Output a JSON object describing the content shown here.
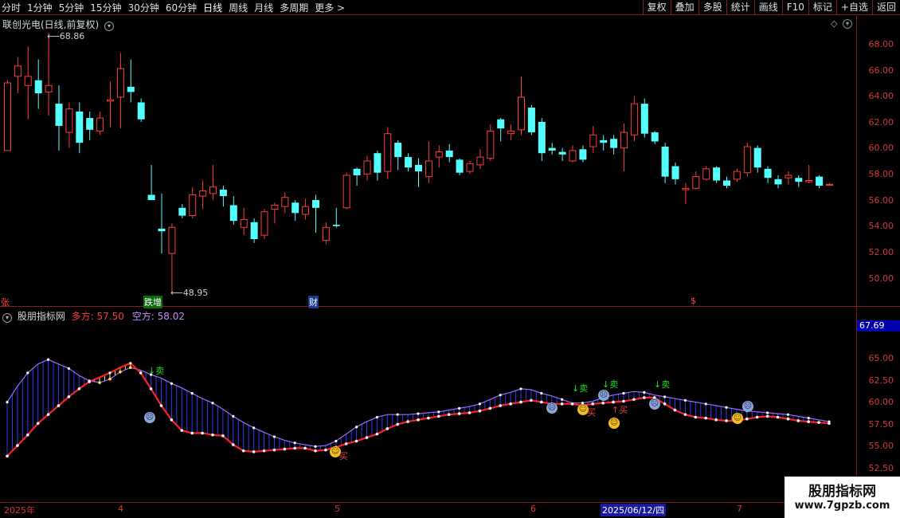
{
  "toolbar": {
    "left": [
      "分时",
      "1分钟",
      "5分钟",
      "15分钟",
      "30分钟",
      "60分钟",
      "日线",
      "周线",
      "月线",
      "多周期",
      "更多 >"
    ],
    "right": [
      "复权",
      "叠加",
      "多股",
      "统计",
      "画线",
      "F10",
      "标记",
      "+自选",
      "返回"
    ]
  },
  "main": {
    "title": "联创光电(日线,前复权)",
    "high_label": "68.86",
    "low_label": "48.95",
    "price_ticks": [
      "68.00",
      "66.00",
      "64.00",
      "62.00",
      "60.00",
      "58.00",
      "56.00",
      "54.00",
      "52.00",
      "50.00"
    ],
    "tags": {
      "zhang": "张",
      "diezeng": "跌增",
      "cai": "财",
      "dollar": "$"
    }
  },
  "indicator": {
    "name": "股朋指标网",
    "duo_label": "多方:",
    "duo_value": "57.50",
    "kong_label": "空方:",
    "kong_value": "58.02",
    "current_value": "67.69",
    "ticks": [
      "65.00",
      "62.50",
      "60.00",
      "57.50",
      "55.00",
      "52.50"
    ],
    "sell_label": "↓卖",
    "buy_label": "↑买",
    "buy_label2": "买"
  },
  "dates": {
    "d1": "2025年",
    "d2": "4",
    "d3": "5",
    "d4": "6",
    "d5": "2025/06/12/四",
    "d6": "7"
  },
  "watermark": {
    "line1": "股朋指标网",
    "line2": "www.7gpzb.com"
  },
  "colors": {
    "up": "#ff3b3b",
    "down": "#54ffff",
    "frame": "#8b1a1a",
    "duo": "#ff2222",
    "kong": "#9a6cff"
  },
  "chart_data": {
    "type": "candlestick",
    "ylim": [
      48.5,
      69.5
    ],
    "candles": [
      {
        "o": 59.8,
        "c": 65.0,
        "h": 65.2,
        "l": 60.5
      },
      {
        "o": 65.5,
        "c": 66.3,
        "h": 67.0,
        "l": 64.2
      },
      {
        "o": 64.8,
        "c": 65.5,
        "h": 67.8,
        "l": 62.2
      },
      {
        "o": 65.2,
        "c": 64.2,
        "h": 66.8,
        "l": 63.0
      },
      {
        "o": 64.3,
        "c": 64.8,
        "h": 68.86,
        "l": 62.5
      },
      {
        "o": 63.4,
        "c": 61.7,
        "h": 64.8,
        "l": 59.8
      },
      {
        "o": 61.2,
        "c": 63.0,
        "h": 63.5,
        "l": 60.0
      },
      {
        "o": 62.8,
        "c": 60.4,
        "h": 63.5,
        "l": 59.6
      },
      {
        "o": 62.3,
        "c": 61.4,
        "h": 62.8,
        "l": 60.6
      },
      {
        "o": 61.3,
        "c": 62.3,
        "h": 62.8,
        "l": 61.0
      },
      {
        "o": 63.6,
        "c": 63.7,
        "h": 65.1,
        "l": 61.6
      },
      {
        "o": 63.9,
        "c": 66.1,
        "h": 67.3,
        "l": 61.5
      },
      {
        "o": 64.7,
        "c": 64.3,
        "h": 66.8,
        "l": 63.5
      },
      {
        "o": 63.5,
        "c": 62.2,
        "h": 63.8,
        "l": 62.0
      },
      {
        "o": 56.4,
        "c": 56.0,
        "h": 58.7,
        "l": 56.0
      },
      {
        "o": 53.8,
        "c": 53.6,
        "h": 56.5,
        "l": 51.9
      },
      {
        "o": 51.9,
        "c": 53.9,
        "h": 54.2,
        "l": 48.95
      },
      {
        "o": 55.4,
        "c": 54.8,
        "h": 55.7,
        "l": 54.6
      },
      {
        "o": 54.8,
        "c": 56.4,
        "h": 57.0,
        "l": 54.6
      },
      {
        "o": 56.3,
        "c": 56.7,
        "h": 57.5,
        "l": 55.3
      },
      {
        "o": 56.5,
        "c": 57.0,
        "h": 58.7,
        "l": 56.0
      },
      {
        "o": 56.8,
        "c": 56.3,
        "h": 57.1,
        "l": 55.5
      },
      {
        "o": 55.6,
        "c": 54.4,
        "h": 56.3,
        "l": 54.1
      },
      {
        "o": 53.9,
        "c": 54.5,
        "h": 55.4,
        "l": 53.3
      },
      {
        "o": 54.3,
        "c": 53.0,
        "h": 54.6,
        "l": 52.7
      },
      {
        "o": 53.3,
        "c": 55.1,
        "h": 55.3,
        "l": 53.0
      },
      {
        "o": 55.3,
        "c": 55.6,
        "h": 55.8,
        "l": 54.2
      },
      {
        "o": 55.5,
        "c": 56.2,
        "h": 56.6,
        "l": 55.0
      },
      {
        "o": 55.8,
        "c": 55.0,
        "h": 56.0,
        "l": 54.4
      },
      {
        "o": 54.9,
        "c": 55.5,
        "h": 56.1,
        "l": 54.5
      },
      {
        "o": 56.0,
        "c": 55.4,
        "h": 56.4,
        "l": 53.5
      },
      {
        "o": 52.9,
        "c": 53.9,
        "h": 54.3,
        "l": 52.6
      },
      {
        "o": 54.1,
        "c": 54.0,
        "h": 55.4,
        "l": 53.9
      },
      {
        "o": 55.4,
        "c": 57.9,
        "h": 58.1,
        "l": 55.3
      },
      {
        "o": 58.4,
        "c": 57.9,
        "h": 58.5,
        "l": 57.1
      },
      {
        "o": 58.0,
        "c": 59.0,
        "h": 59.4,
        "l": 57.5
      },
      {
        "o": 59.6,
        "c": 58.1,
        "h": 59.8,
        "l": 57.5
      },
      {
        "o": 58.2,
        "c": 61.1,
        "h": 61.6,
        "l": 57.6
      },
      {
        "o": 60.4,
        "c": 59.3,
        "h": 60.6,
        "l": 58.3
      },
      {
        "o": 59.3,
        "c": 58.5,
        "h": 59.6,
        "l": 58.2
      },
      {
        "o": 58.7,
        "c": 58.2,
        "h": 59.2,
        "l": 57.0
      },
      {
        "o": 57.8,
        "c": 59.0,
        "h": 60.5,
        "l": 57.3
      },
      {
        "o": 59.3,
        "c": 59.7,
        "h": 60.2,
        "l": 58.5
      },
      {
        "o": 59.8,
        "c": 59.3,
        "h": 60.3,
        "l": 58.9
      },
      {
        "o": 59.1,
        "c": 58.1,
        "h": 59.2,
        "l": 57.9
      },
      {
        "o": 58.2,
        "c": 58.8,
        "h": 59.0,
        "l": 58.0
      },
      {
        "o": 58.7,
        "c": 59.3,
        "h": 59.9,
        "l": 58.4
      },
      {
        "o": 59.2,
        "c": 61.3,
        "h": 61.8,
        "l": 59.0
      },
      {
        "o": 62.2,
        "c": 61.5,
        "h": 62.3,
        "l": 60.5
      },
      {
        "o": 61.1,
        "c": 61.3,
        "h": 61.8,
        "l": 60.6
      },
      {
        "o": 61.4,
        "c": 63.9,
        "h": 65.5,
        "l": 61.0
      },
      {
        "o": 63.1,
        "c": 61.2,
        "h": 63.3,
        "l": 61.0
      },
      {
        "o": 62.0,
        "c": 59.6,
        "h": 62.3,
        "l": 59.0
      },
      {
        "o": 60.0,
        "c": 59.8,
        "h": 60.4,
        "l": 59.5
      },
      {
        "o": 59.7,
        "c": 59.5,
        "h": 60.0,
        "l": 59.0
      },
      {
        "o": 59.0,
        "c": 59.8,
        "h": 60.2,
        "l": 58.9
      },
      {
        "o": 59.9,
        "c": 59.1,
        "h": 60.2,
        "l": 58.9
      },
      {
        "o": 60.1,
        "c": 61.0,
        "h": 61.7,
        "l": 59.6
      },
      {
        "o": 60.6,
        "c": 60.4,
        "h": 61.0,
        "l": 59.8
      },
      {
        "o": 60.7,
        "c": 60.0,
        "h": 61.0,
        "l": 59.5
      },
      {
        "o": 60.0,
        "c": 61.2,
        "h": 61.9,
        "l": 58.2
      },
      {
        "o": 61.0,
        "c": 63.4,
        "h": 64.0,
        "l": 60.5
      },
      {
        "o": 63.4,
        "c": 61.1,
        "h": 63.8,
        "l": 60.8
      },
      {
        "o": 61.2,
        "c": 60.5,
        "h": 61.3,
        "l": 60.3
      },
      {
        "o": 60.1,
        "c": 57.8,
        "h": 60.4,
        "l": 57.3
      },
      {
        "o": 58.6,
        "c": 57.6,
        "h": 58.9,
        "l": 57.2
      },
      {
        "o": 56.8,
        "c": 56.9,
        "h": 57.3,
        "l": 55.7
      },
      {
        "o": 56.9,
        "c": 57.8,
        "h": 58.2,
        "l": 56.8
      },
      {
        "o": 57.6,
        "c": 58.4,
        "h": 58.6,
        "l": 57.5
      },
      {
        "o": 58.5,
        "c": 57.5,
        "h": 58.6,
        "l": 57.3
      },
      {
        "o": 57.5,
        "c": 57.1,
        "h": 57.8,
        "l": 56.9
      },
      {
        "o": 57.6,
        "c": 58.2,
        "h": 58.4,
        "l": 57.4
      },
      {
        "o": 58.1,
        "c": 60.1,
        "h": 60.4,
        "l": 57.8
      },
      {
        "o": 60.0,
        "c": 58.5,
        "h": 60.2,
        "l": 58.1
      },
      {
        "o": 58.4,
        "c": 57.7,
        "h": 58.6,
        "l": 57.3
      },
      {
        "o": 57.6,
        "c": 57.2,
        "h": 57.9,
        "l": 56.9
      },
      {
        "o": 57.7,
        "c": 57.9,
        "h": 58.2,
        "l": 57.2
      },
      {
        "o": 57.7,
        "c": 57.4,
        "h": 57.9,
        "l": 57.0
      },
      {
        "o": 57.4,
        "c": 57.5,
        "h": 58.7,
        "l": 57.3
      },
      {
        "o": 57.8,
        "c": 57.1,
        "h": 57.9,
        "l": 56.9
      },
      {
        "o": 57.2,
        "c": 57.2,
        "h": 57.3,
        "l": 57.1
      }
    ],
    "indicator_ylim": [
      51.5,
      68.0
    ],
    "duo": [
      53.9,
      55.1,
      56.3,
      57.6,
      58.6,
      59.6,
      60.6,
      61.5,
      62.3,
      62.8,
      63.3,
      63.9,
      64.4,
      63.3,
      61.5,
      59.6,
      58.0,
      56.8,
      56.5,
      56.5,
      56.3,
      56.2,
      55.2,
      54.5,
      54.4,
      54.5,
      54.6,
      54.7,
      54.8,
      54.8,
      54.5,
      54.6,
      54.9,
      55.3,
      55.6,
      56.0,
      56.4,
      57.0,
      57.5,
      57.8,
      58.0,
      58.2,
      58.4,
      58.6,
      58.7,
      58.8,
      59.0,
      59.3,
      59.6,
      59.8,
      60.0,
      60.2,
      60.0,
      59.8,
      59.8,
      59.8,
      59.6,
      59.8,
      59.9,
      60.0,
      60.1,
      60.3,
      60.5,
      60.5,
      59.8,
      59.1,
      58.6,
      58.3,
      58.2,
      58.0,
      57.9,
      57.9,
      58.1,
      58.3,
      58.4,
      58.3,
      58.1,
      57.9,
      57.8,
      57.7,
      57.6
    ],
    "kong": [
      60.0,
      61.8,
      63.3,
      64.3,
      64.8,
      64.3,
      63.8,
      63.0,
      62.4,
      62.2,
      62.6,
      63.4,
      63.9,
      63.6,
      63.1,
      62.7,
      62.1,
      61.6,
      61.0,
      60.4,
      59.9,
      59.2,
      58.4,
      57.7,
      57.1,
      56.6,
      56.1,
      55.7,
      55.4,
      55.2,
      55.0,
      55.1,
      55.6,
      56.4,
      57.2,
      57.8,
      58.3,
      58.6,
      58.6,
      58.6,
      58.7,
      58.8,
      58.9,
      59.1,
      59.3,
      59.5,
      59.8,
      60.3,
      60.8,
      61.1,
      61.5,
      61.4,
      61.0,
      60.7,
      60.3,
      59.9,
      59.9,
      60.1,
      60.5,
      60.8,
      61.0,
      61.2,
      61.1,
      60.8,
      60.6,
      60.4,
      60.2,
      60.0,
      59.8,
      59.6,
      59.4,
      59.2,
      59.0,
      58.9,
      58.8,
      58.7,
      58.6,
      58.4,
      58.2,
      58.0,
      57.8
    ]
  }
}
